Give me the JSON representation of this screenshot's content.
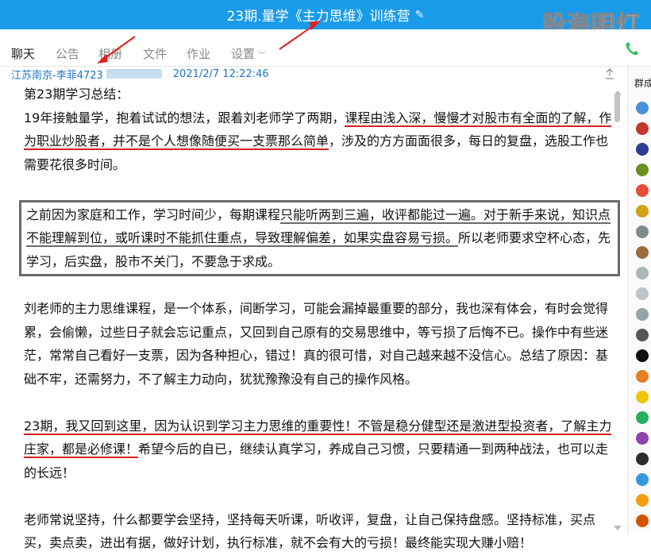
{
  "window": {
    "title": "23期.量学《主力思维》训练营",
    "watermark": "股海明灯"
  },
  "tabs": [
    {
      "label": "聊天",
      "active": true
    },
    {
      "label": "公告",
      "active": false
    },
    {
      "label": "相册",
      "active": false
    },
    {
      "label": "文件",
      "active": false
    },
    {
      "label": "作业",
      "active": false
    },
    {
      "label": "设置",
      "active": false
    }
  ],
  "message": {
    "sender_prefix": "江苏南京-李菲4723",
    "time": "2021/2/7 12:22:46",
    "title": "第23期学习总结：",
    "p1": {
      "a": "19年接触量学，抱着试试的想法，跟着刘老师学了两期，",
      "b": "课程由浅入深，慢慢才对股市有全面的了解，",
      "c": "作为职业炒股者，并不是个人想像随便买一支票那么简单",
      "d": "，涉及的方方面面很多，每日的复盘，选股工作也需要花很多时间。"
    },
    "p2": {
      "a": "之前因为家庭和工作，学习时间少，每期课程",
      "b": "只能听两到三遍，收评都能过一遍。对于新手来说，知识点不能理解到位，或听课时不能抓住重点，",
      "c": "导致理解偏差，如果实盘容易亏损。",
      "d": "所以老师要求空杯心态，先学习，后实盘，股市不关门，不要急于求成。"
    },
    "p3": "刘老师的主力思维课程，是一个体系，间断学习，可能会漏掉最重要的部分，我也深有体会，有时会觉得累，会偷懒，过些日子就会忘记重点，又回到自己原有的交易思维中，等亏损了后悔不已。操作中有些迷茫，常常自己看好一支票，因为各种担心，错过！真的很可惜，对自己越来越不没信心。总结了原因：基础不牢，还需努力，不了解主力动向，犹犹豫豫没有自己的操作风格。",
    "p4": {
      "a": "23期，我又回到这里，因为认识到学习主力思维的重要性！不管是稳分健型还是激进型投资者，了解主力庄家，都是必修课！",
      "b": "希望今后的自已，继续认真学习，养成自己习惯，只要精通一到两种战法，也可以走的长远！"
    },
    "p5": "老师常说坚持，什么都要学会坚持，坚持每天听课，听收评，复盘，让自己保持盘感。坚持标准，买点买，卖点卖，进出有据，做好计划，执行标准，就不会有大的亏损！最终能实现大赚小赔！"
  },
  "side": {
    "label": "群成员"
  },
  "colors": {
    "titlebar": "#1a9bea",
    "sender": "#1f74c8",
    "underline_red": "#d62020",
    "underline_gray": "#6b6b6b"
  }
}
